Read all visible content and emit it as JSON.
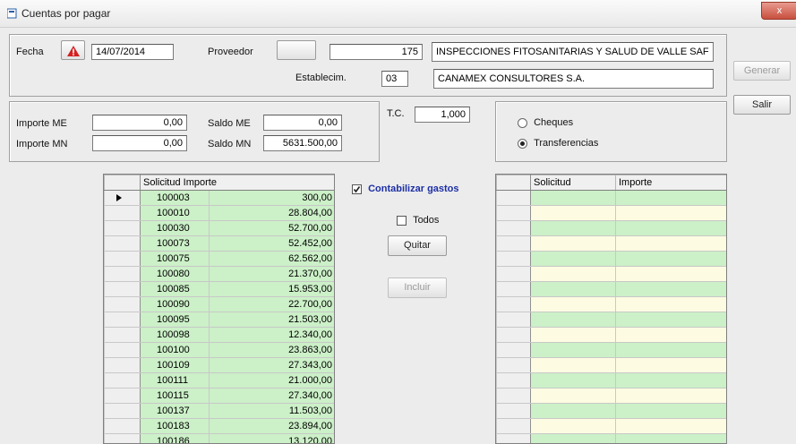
{
  "window": {
    "title": "Cuentas por pagar",
    "close_label": "x"
  },
  "header": {
    "fecha_label": "Fecha",
    "fecha_value": "14/07/2014",
    "proveedor_label": "Proveedor",
    "proveedor_code": "175",
    "proveedor_name": "INSPECCIONES FITOSANITARIAS Y SALUD DE VALLE SAF",
    "establecimiento_label": "Establecim.",
    "establecimiento_code": "03",
    "establecimiento_name": "CANAMEX CONSULTORES S.A."
  },
  "amounts": {
    "importe_me_label": "Importe ME",
    "importe_me_value": "0,00",
    "importe_mn_label": "Importe MN",
    "importe_mn_value": "0,00",
    "saldo_me_label": "Saldo ME",
    "saldo_me_value": "0,00",
    "saldo_mn_label": "Saldo MN",
    "saldo_mn_value": "5631.500,00",
    "tc_label": "T.C.",
    "tc_value": "1,000"
  },
  "payment": {
    "cheques_label": "Cheques",
    "transferencias_label": "Transferencias",
    "selected": "Transferencias"
  },
  "right_buttons": {
    "generar_label": "Generar",
    "salir_label": "Salir"
  },
  "middle": {
    "contabilizar_label": "Contabilizar gastos",
    "todos_label": "Todos",
    "quitar_label": "Quitar",
    "incluir_label": "Incluir"
  },
  "left_grid": {
    "columns": [
      "Solicitud",
      "Importe"
    ],
    "rows": [
      {
        "solicitud": "100003",
        "importe": "300,00",
        "current": true
      },
      {
        "solicitud": "100010",
        "importe": "28.804,00"
      },
      {
        "solicitud": "100030",
        "importe": "52.700,00"
      },
      {
        "solicitud": "100073",
        "importe": "52.452,00"
      },
      {
        "solicitud": "100075",
        "importe": "62.562,00"
      },
      {
        "solicitud": "100080",
        "importe": "21.370,00"
      },
      {
        "solicitud": "100085",
        "importe": "15.953,00"
      },
      {
        "solicitud": "100090",
        "importe": "22.700,00"
      },
      {
        "solicitud": "100095",
        "importe": "21.503,00"
      },
      {
        "solicitud": "100098",
        "importe": "12.340,00"
      },
      {
        "solicitud": "100100",
        "importe": "23.863,00"
      },
      {
        "solicitud": "100109",
        "importe": "27.343,00"
      },
      {
        "solicitud": "100111",
        "importe": "21.000,00"
      },
      {
        "solicitud": "100115",
        "importe": "27.340,00"
      },
      {
        "solicitud": "100137",
        "importe": "11.503,00"
      },
      {
        "solicitud": "100183",
        "importe": "23.894,00"
      },
      {
        "solicitud": "100186",
        "importe": "13.120,00"
      }
    ]
  },
  "right_grid": {
    "columns": [
      "Solicitud",
      "Importe"
    ],
    "rows": [
      "",
      "",
      "",
      "",
      "",
      "",
      "",
      "",
      "",
      "",
      "",
      "",
      "",
      "",
      "",
      "",
      ""
    ]
  }
}
